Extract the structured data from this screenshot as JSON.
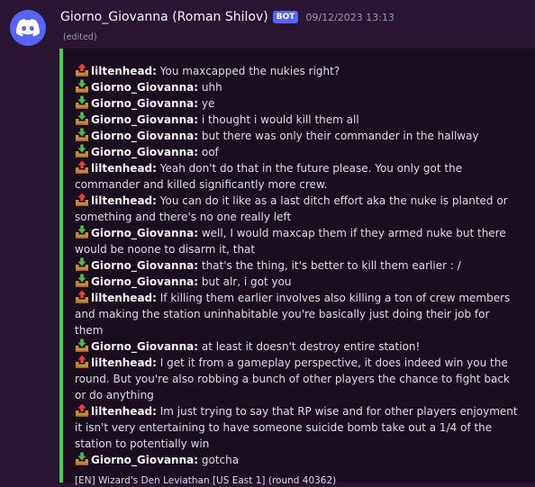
{
  "header": {
    "username": "Giorno_Giovanna (Roman Shilov)",
    "bot_tag": "BOT",
    "timestamp": "09/12/2023 13:13",
    "edited": "(edited)"
  },
  "colors": {
    "accent": "#4ad04e",
    "brand": "#5865f2",
    "background": "#2a1632",
    "embed_background": "#1b0e21"
  },
  "embed": {
    "messages": [
      {
        "icon": "arrow-up-box-icon",
        "author": "liltenhead:",
        "text": "You maxcapped the nukies right?"
      },
      {
        "icon": "arrow-down-box-icon",
        "author": "Giorno_Giovanna:",
        "text": "uhh"
      },
      {
        "icon": "arrow-down-box-icon",
        "author": "Giorno_Giovanna:",
        "text": "ye"
      },
      {
        "icon": "arrow-down-box-icon",
        "author": "Giorno_Giovanna:",
        "text": "i thought i would kill them all"
      },
      {
        "icon": "arrow-down-box-icon",
        "author": "Giorno_Giovanna:",
        "text": "but there was only their commander in the hallway"
      },
      {
        "icon": "arrow-down-box-icon",
        "author": "Giorno_Giovanna:",
        "text": "oof"
      },
      {
        "icon": "arrow-up-box-icon",
        "author": "liltenhead:",
        "text": "Yeah don't do that in the future please. You only got the commander and killed significantly more crew."
      },
      {
        "icon": "arrow-up-box-icon",
        "author": "liltenhead:",
        "text": "You can do it like as a last ditch effort aka the nuke is planted or something and there's no one really left"
      },
      {
        "icon": "arrow-down-box-icon",
        "author": "Giorno_Giovanna:",
        "text": "well, I would maxcap them if they armed nuke but there would be noone to disarm it, that"
      },
      {
        "icon": "arrow-down-box-icon",
        "author": "Giorno_Giovanna:",
        "text": "that's the thing, it's better to kill them earlier : /"
      },
      {
        "icon": "arrow-down-box-icon",
        "author": "Giorno_Giovanna:",
        "text": "but alr, i got you"
      },
      {
        "icon": "arrow-up-box-icon",
        "author": "liltenhead:",
        "text": "If killing them earlier involves also killing a ton of crew members and making the station uninhabitable you're basically just doing their job for them"
      },
      {
        "icon": "arrow-down-box-icon",
        "author": "Giorno_Giovanna:",
        "text": "at least it doesn't destroy entire station!"
      },
      {
        "icon": "arrow-up-box-icon",
        "author": "liltenhead:",
        "text": "I get it from a gameplay perspective, it does indeed win you the round. But you're also robbing a bunch of other players the chance to fight back or do anything"
      },
      {
        "icon": "arrow-up-box-icon",
        "author": "liltenhead:",
        "text": "Im just trying to say that RP wise and for other players enjoyment it isn't very entertaining to have someone suicide bomb take out a 1/4 of the station to potentially win"
      },
      {
        "icon": "arrow-down-box-icon",
        "author": "Giorno_Giovanna:",
        "text": "gotcha"
      }
    ],
    "footer": "[EN] Wizard's Den Leviathan [US East 1] (round 40362)"
  }
}
